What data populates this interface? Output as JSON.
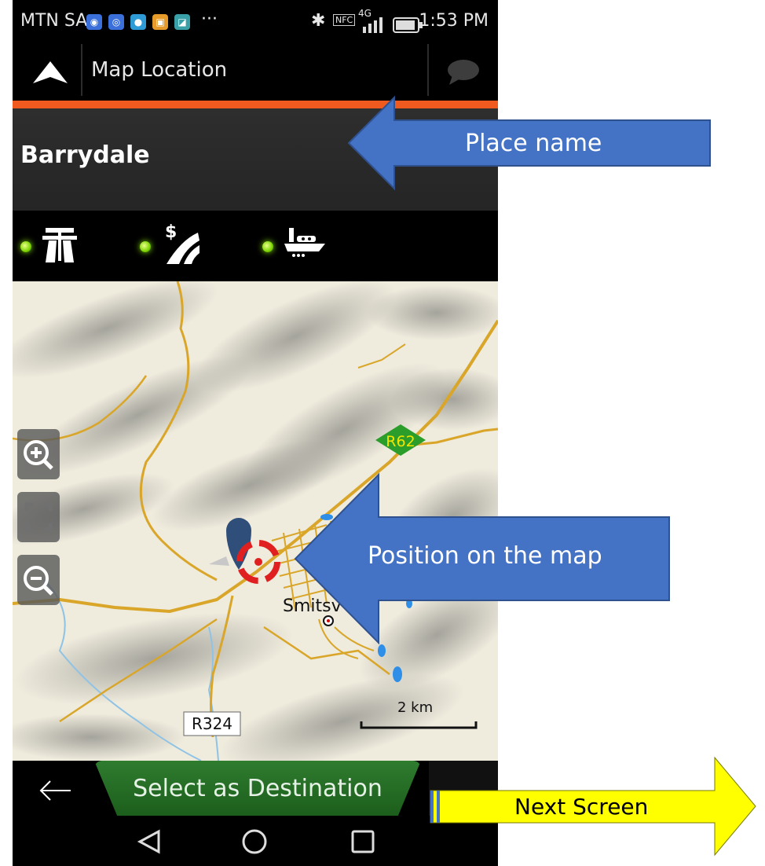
{
  "status_bar": {
    "carrier": "MTN SA",
    "overflow": "···",
    "network": "4G",
    "time": "1:53 PM"
  },
  "header": {
    "title": "Map Location"
  },
  "place": {
    "name": "Barrydale"
  },
  "route_filters": [
    {
      "name": "motorways",
      "icon": "motorway-icon",
      "enabled": true
    },
    {
      "name": "toll roads",
      "icon": "toll-road-icon",
      "enabled": true
    },
    {
      "name": "ferries",
      "icon": "ferry-icon",
      "enabled": true
    }
  ],
  "map": {
    "road_labels": [
      "R62",
      "R324"
    ],
    "town_label": "Smitsv",
    "scale_label": "2 km"
  },
  "bottom": {
    "destination_button": "Select as Destination"
  },
  "annotations": {
    "place_name": "Place name",
    "position": "Position on the map",
    "next_screen": "Next Screen"
  },
  "colors": {
    "accent_orange": "#f05a1e",
    "destination_green": "#1f661f",
    "annotation_blue": "#4472c4",
    "annotation_yellow": "#ffff00",
    "route_badge_green": "#2a9d2a",
    "filter_led_green": "#7bd400"
  }
}
